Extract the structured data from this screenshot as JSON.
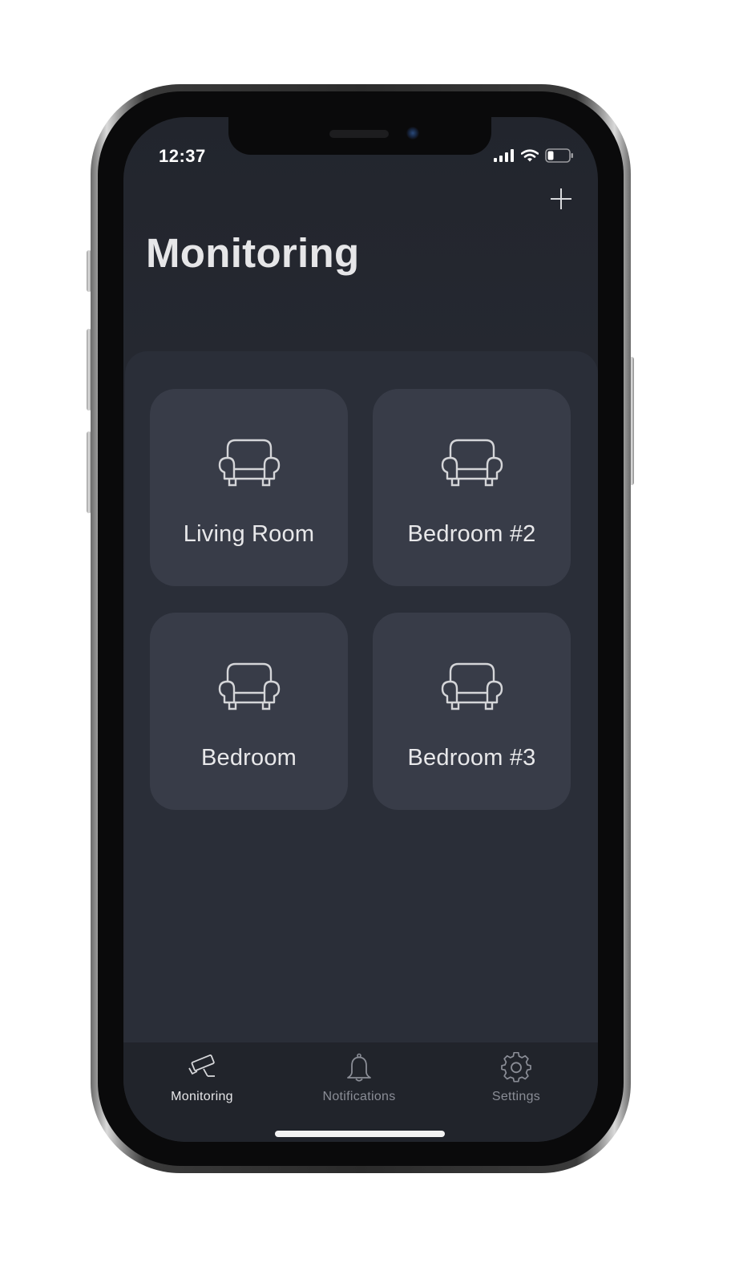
{
  "status_bar": {
    "time": "12:37",
    "icons": [
      "cellular-signal-icon",
      "wifi-icon",
      "battery-icon"
    ]
  },
  "header": {
    "title": "Monitoring",
    "add_icon": "plus-icon"
  },
  "rooms": [
    {
      "label": "Living Room",
      "icon": "armchair-icon"
    },
    {
      "label": "Bedroom #2",
      "icon": "armchair-icon"
    },
    {
      "label": "Bedroom",
      "icon": "armchair-icon"
    },
    {
      "label": "Bedroom #3",
      "icon": "armchair-icon"
    }
  ],
  "tab_bar": {
    "active": "Monitoring",
    "tabs": [
      {
        "label": "Monitoring",
        "icon": "security-camera-icon"
      },
      {
        "label": "Notifications",
        "icon": "bell-icon"
      },
      {
        "label": "Settings",
        "icon": "gear-icon"
      }
    ]
  },
  "colors": {
    "background": "#262931",
    "card": "#383c48",
    "panel": "#2a2e38",
    "tab_bar": "#21242b",
    "text_primary": "#e6e6e8",
    "text_secondary": "#8a8d96"
  }
}
